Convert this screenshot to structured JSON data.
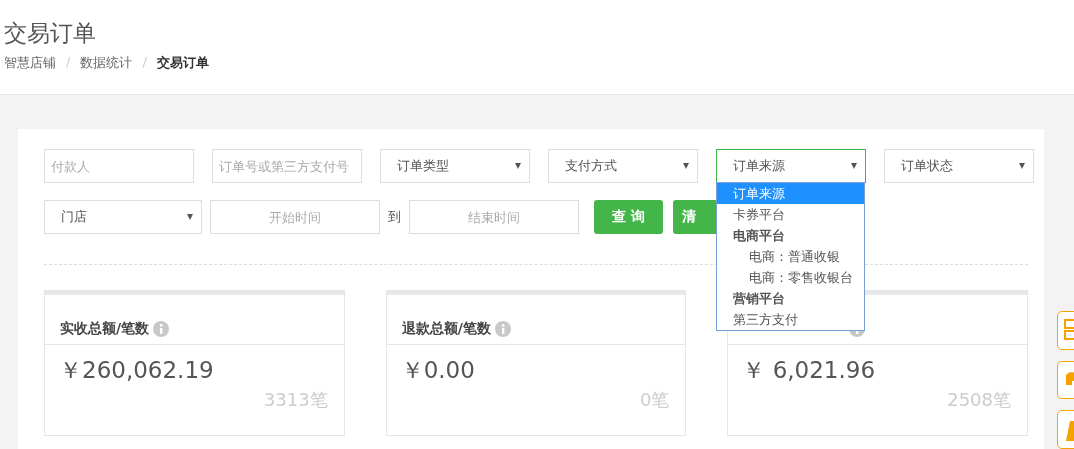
{
  "page": {
    "title": "交易订单",
    "breadcrumb_separator": "/",
    "breadcrumb": [
      {
        "label": "智慧店铺",
        "current": false
      },
      {
        "label": "数据统计",
        "current": false
      },
      {
        "label": "交易订单",
        "current": true
      }
    ]
  },
  "filters_row1": [
    {
      "kind": "input",
      "placeholder": "付款人"
    },
    {
      "kind": "input",
      "placeholder": "订单号或第三方支付号"
    },
    {
      "kind": "select",
      "value": "订单类型",
      "open": false
    },
    {
      "kind": "select",
      "value": "支付方式",
      "open": false
    },
    {
      "kind": "select",
      "value": "订单来源",
      "open": true
    },
    {
      "kind": "select",
      "value": "订单状态",
      "open": false
    }
  ],
  "filters_row2": {
    "store": "门店",
    "start_placeholder": "开始时间",
    "to_label": "到",
    "end_placeholder": "结束时间",
    "buttons": [
      "查 询",
      "清"
    ]
  },
  "dropdown": [
    {
      "label": "订单来源",
      "kind": "option",
      "selected": true
    },
    {
      "label": "卡券平台",
      "kind": "option",
      "selected": false
    },
    {
      "label": "电商平台",
      "kind": "group",
      "selected": false,
      "children": [
        {
          "label": "电商：普通收银",
          "kind": "option",
          "selected": false
        },
        {
          "label": "电商：零售收银台",
          "kind": "option",
          "selected": false
        }
      ]
    },
    {
      "label": "营销平台",
      "kind": "group",
      "selected": false
    },
    {
      "label": "第三方支付",
      "kind": "option",
      "selected": false
    }
  ],
  "stats": [
    {
      "title": "实收总额/笔数",
      "amount": "￥260,062.19",
      "count": "3313笔"
    },
    {
      "amount": "￥0.00",
      "count": "0笔",
      "title": "退款总额/笔数"
    },
    {
      "amount": "￥ 6,021.96",
      "count": "2508笔"
    }
  ]
}
